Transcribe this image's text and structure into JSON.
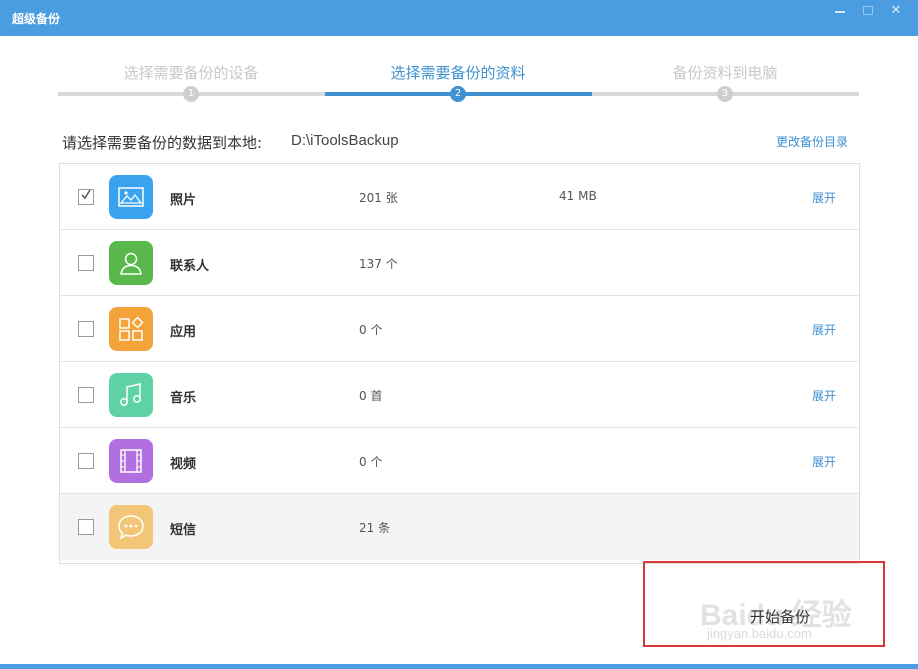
{
  "window": {
    "title": "超级备份"
  },
  "steps": [
    {
      "label": "选择需要备份的设备",
      "number": "1",
      "state": "done"
    },
    {
      "label": "选择需要备份的资料",
      "number": "2",
      "state": "active"
    },
    {
      "label": "备份资料到电脑",
      "number": "3",
      "state": "pending"
    }
  ],
  "backup_dir": {
    "label": "请选择需要备份的数据到本地:",
    "path": "D:\\iToolsBackup",
    "change_label": "更改备份目录"
  },
  "items": [
    {
      "name": "照片",
      "count": "201 张",
      "size": "41 MB",
      "expand": "展开",
      "checked": true,
      "icon": "photo-icon",
      "color": "#3aa3ef"
    },
    {
      "name": "联系人",
      "count": "137 个",
      "size": "",
      "expand": "",
      "checked": false,
      "icon": "contact-icon",
      "color": "#58b84b"
    },
    {
      "name": "应用",
      "count": "0 个",
      "size": "",
      "expand": "展开",
      "checked": false,
      "icon": "app-icon",
      "color": "#f4a23a"
    },
    {
      "name": "音乐",
      "count": "0 首",
      "size": "",
      "expand": "展开",
      "checked": false,
      "icon": "music-icon",
      "color": "#5fd3a6"
    },
    {
      "name": "视频",
      "count": "0 个",
      "size": "",
      "expand": "展开",
      "checked": false,
      "icon": "video-icon",
      "color": "#b26fe0"
    },
    {
      "name": "短信",
      "count": "21 条",
      "size": "",
      "expand": "",
      "checked": false,
      "icon": "message-icon",
      "color": "#f2c676"
    }
  ],
  "actions": {
    "start_backup": "开始备份"
  },
  "watermark": {
    "brand": "Baidu 经验",
    "url": "jingyan.baidu.com"
  },
  "colors": {
    "titlebar": "#4a9de0",
    "accent": "#3d92cf",
    "highlight": "#d83a3a"
  }
}
